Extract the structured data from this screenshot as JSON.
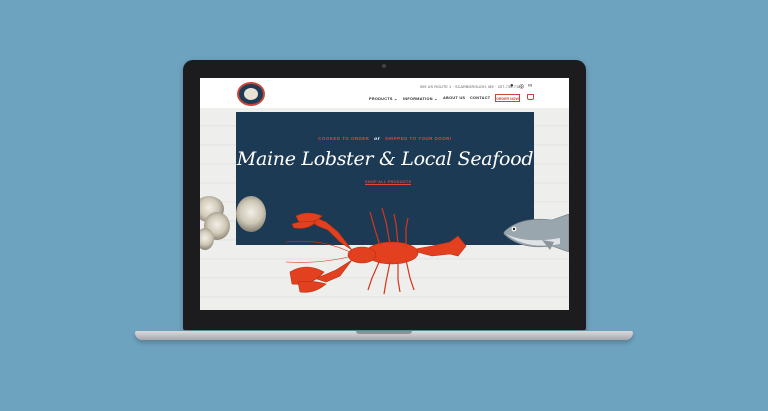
{
  "site": {
    "address": "909 US ROUTE 1 · SCARBOROUGH, ME · 207-730-7101",
    "nav": [
      {
        "label": "PRODUCTS ⌄"
      },
      {
        "label": "INFORMATION ⌄"
      },
      {
        "label": "ABOUT US"
      },
      {
        "label": "CONTACT"
      }
    ],
    "order_button": "ORDER NOW",
    "social_icons": [
      "facebook-icon",
      "instagram-icon",
      "tripadvisor-icon"
    ]
  },
  "hero": {
    "tagline_left": "COOKED TO ORDER",
    "tagline_or": "or",
    "tagline_right": "SHIPPED TO YOUR DOOR!",
    "headline": "Maine Lobster & Local Seafood",
    "cta": "SHOP ALL PRODUCTS"
  },
  "colors": {
    "accent": "#e0483b",
    "navy": "#1d3a55",
    "background": "#6ea3bf"
  }
}
